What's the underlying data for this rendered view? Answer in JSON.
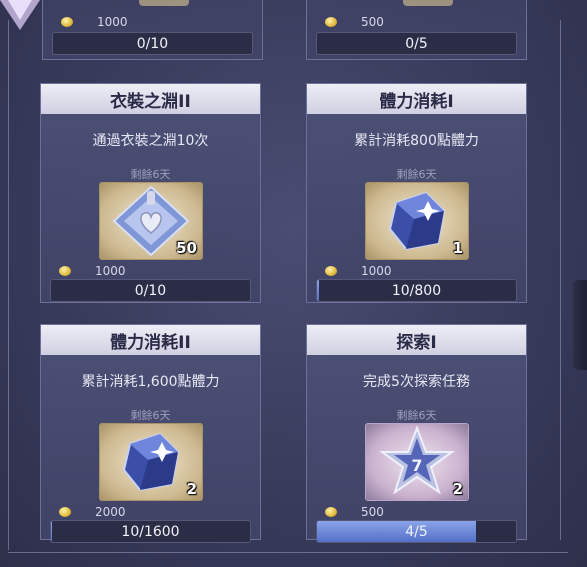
{
  "top_cards": [
    {
      "coin_amount": "1000",
      "progress_text": "0/10",
      "progress_fraction": 0
    },
    {
      "coin_amount": "500",
      "progress_text": "0/5",
      "progress_fraction": 0
    }
  ],
  "cards": [
    {
      "title": "衣裝之淵II",
      "description": "通過衣裝之淵10次",
      "remaining": "剩餘6天",
      "reward_icon": "silver-heart-crystal-icon",
      "reward_qty": "50",
      "coin_amount": "1000",
      "progress_text": "0/10",
      "progress_fraction": 0
    },
    {
      "title": "體力消耗I",
      "description": "累計消耗800點體力",
      "remaining": "剩餘6天",
      "reward_icon": "blue-crystal-cube-icon",
      "reward_qty": "1",
      "coin_amount": "1000",
      "progress_text": "10/800",
      "progress_fraction": 0.0125
    },
    {
      "title": "體力消耗II",
      "description": "累計消耗1,600點體力",
      "remaining": "剩餘6天",
      "reward_icon": "blue-crystal-cube-icon",
      "reward_qty": "2",
      "coin_amount": "2000",
      "progress_text": "10/1600",
      "progress_fraction": 0.00625
    },
    {
      "title": "探索I",
      "description": "完成5次探索任務",
      "remaining": "剩餘6天",
      "reward_icon": "silver-star-icon",
      "reward_qty": "2",
      "coin_amount": "500",
      "progress_text": "4/5",
      "progress_fraction": 0.8
    }
  ],
  "colors": {
    "accent": "#5470c8",
    "coin": "#e1b93a",
    "title_bar": "#e6e6f2"
  }
}
